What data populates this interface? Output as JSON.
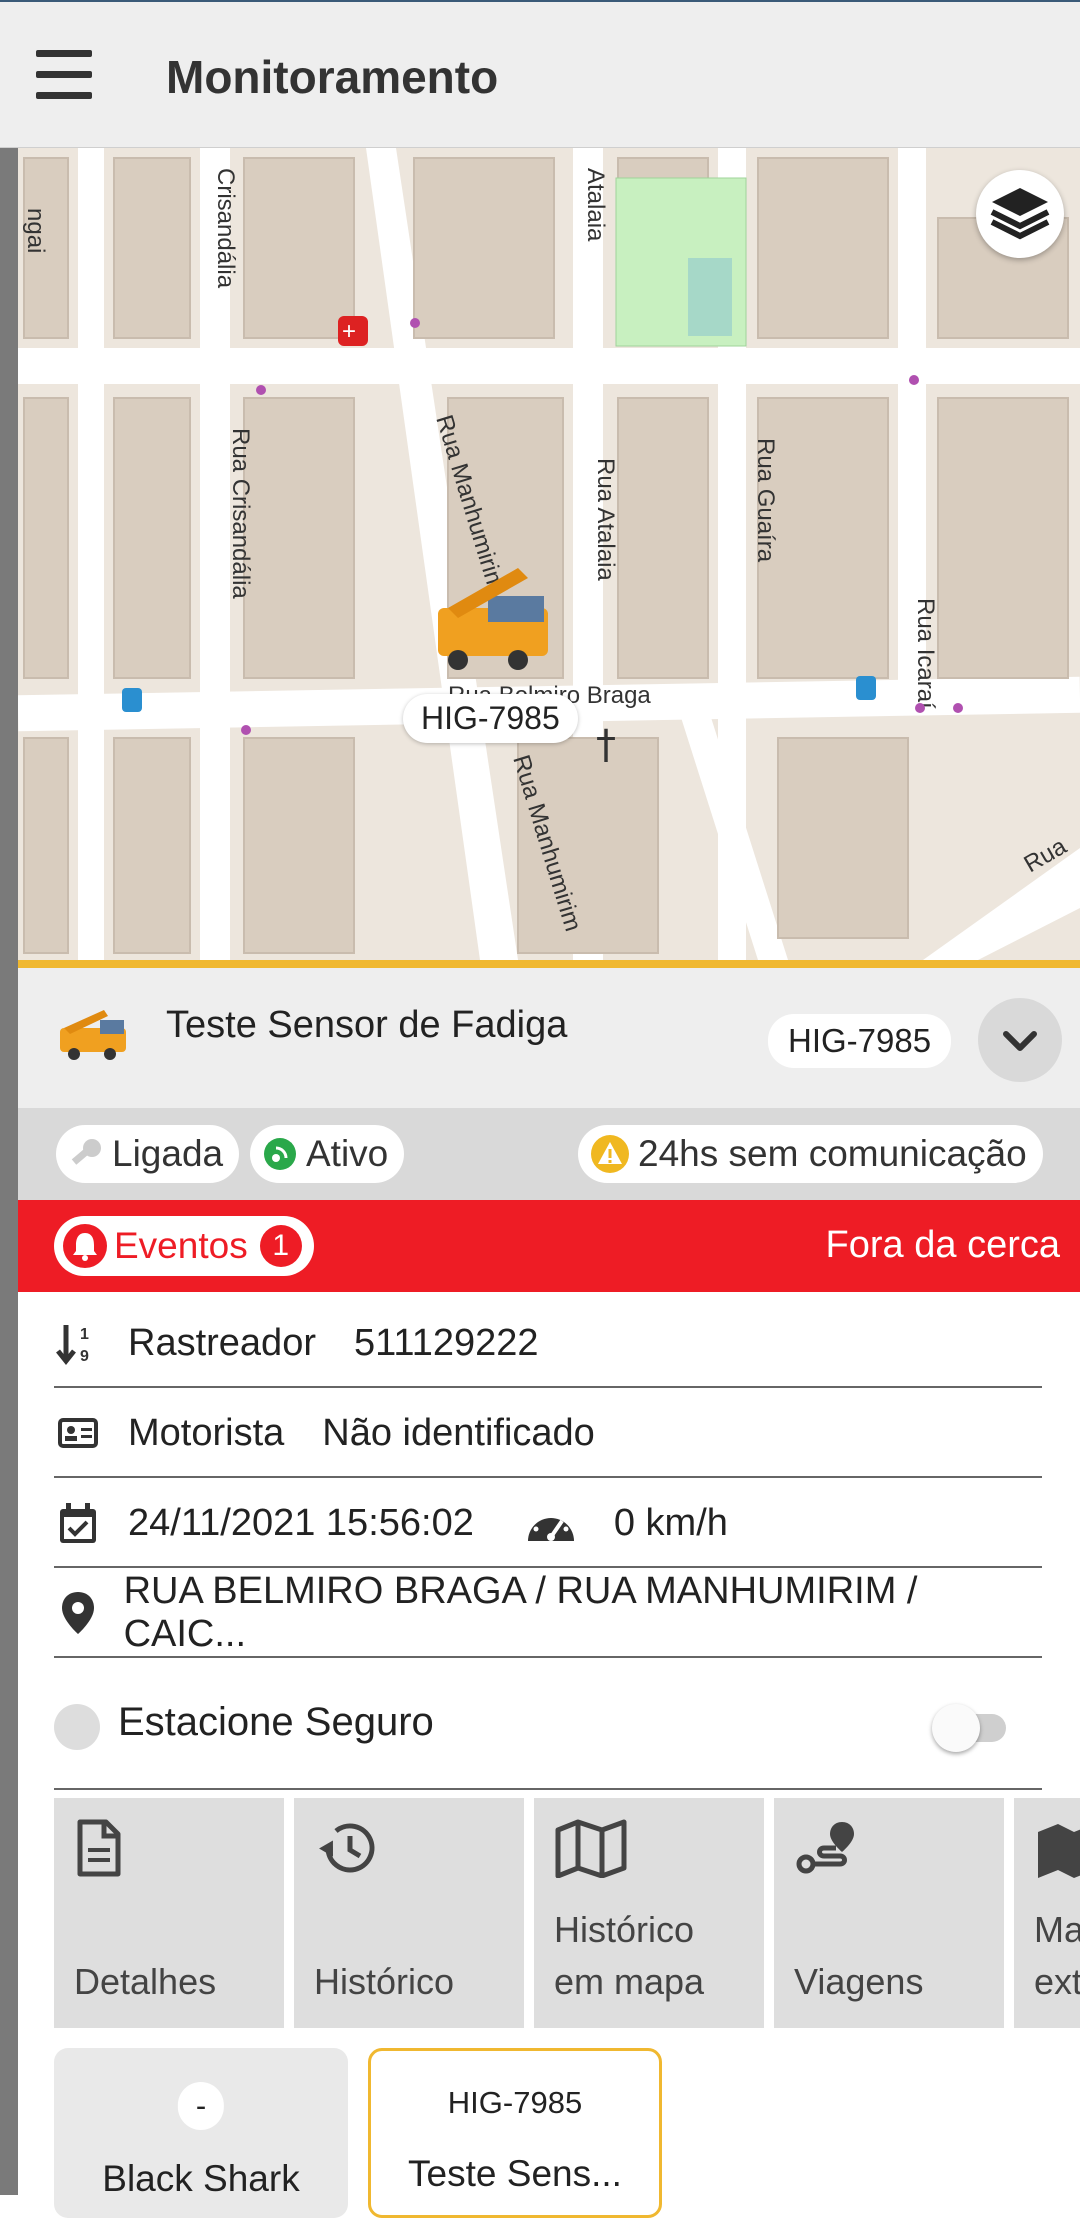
{
  "header": {
    "title": "Monitoramento"
  },
  "map": {
    "vehicle_plate": "HIG-7985",
    "street_labels": [
      "ngai",
      "Crisandália",
      "Atalaia",
      "Rua Crisandália",
      "Rua Manhumirim",
      "Rua Atalaia",
      "Rua Guaíra",
      "Rua Icaraí",
      "Rua Belmiro Braga",
      "Rua Manhumirim",
      "Rua"
    ]
  },
  "vehicle": {
    "name": "Teste Sensor de Fadiga",
    "plate": "HIG-7985"
  },
  "status": {
    "ignition": "Ligada",
    "active": "Ativo",
    "communication": "24hs sem comunicação"
  },
  "events": {
    "label": "Eventos",
    "count": "1",
    "message": "Fora da cerca"
  },
  "info": {
    "tracker_label": "Rastreador",
    "tracker_value": "511129222",
    "driver_label": "Motorista",
    "driver_value": "Não identificado",
    "datetime": "24/11/2021 15:56:02",
    "speed": "0 km/h",
    "address": "RUA BELMIRO BRAGA / RUA MANHUMIRIM / CAIC..."
  },
  "safe_park": {
    "label": "Estacione Seguro",
    "enabled": false
  },
  "actions": [
    {
      "label": "Detalhes",
      "icon": "document-icon"
    },
    {
      "label": "Histórico",
      "icon": "history-icon"
    },
    {
      "label": "Histórico em mapa",
      "icon": "map-icon"
    },
    {
      "label": "Viagens",
      "icon": "route-icon"
    },
    {
      "label": "Ma ext",
      "icon": "map-pin-icon"
    }
  ],
  "vehicle_cards": [
    {
      "plate": "-",
      "name": "Black Shark"
    },
    {
      "plate": "HIG-7985",
      "name": "Teste Sens..."
    }
  ],
  "colors": {
    "accent": "#f0b830",
    "events_red": "#ee1c25",
    "header_bg": "#eeeeee"
  }
}
